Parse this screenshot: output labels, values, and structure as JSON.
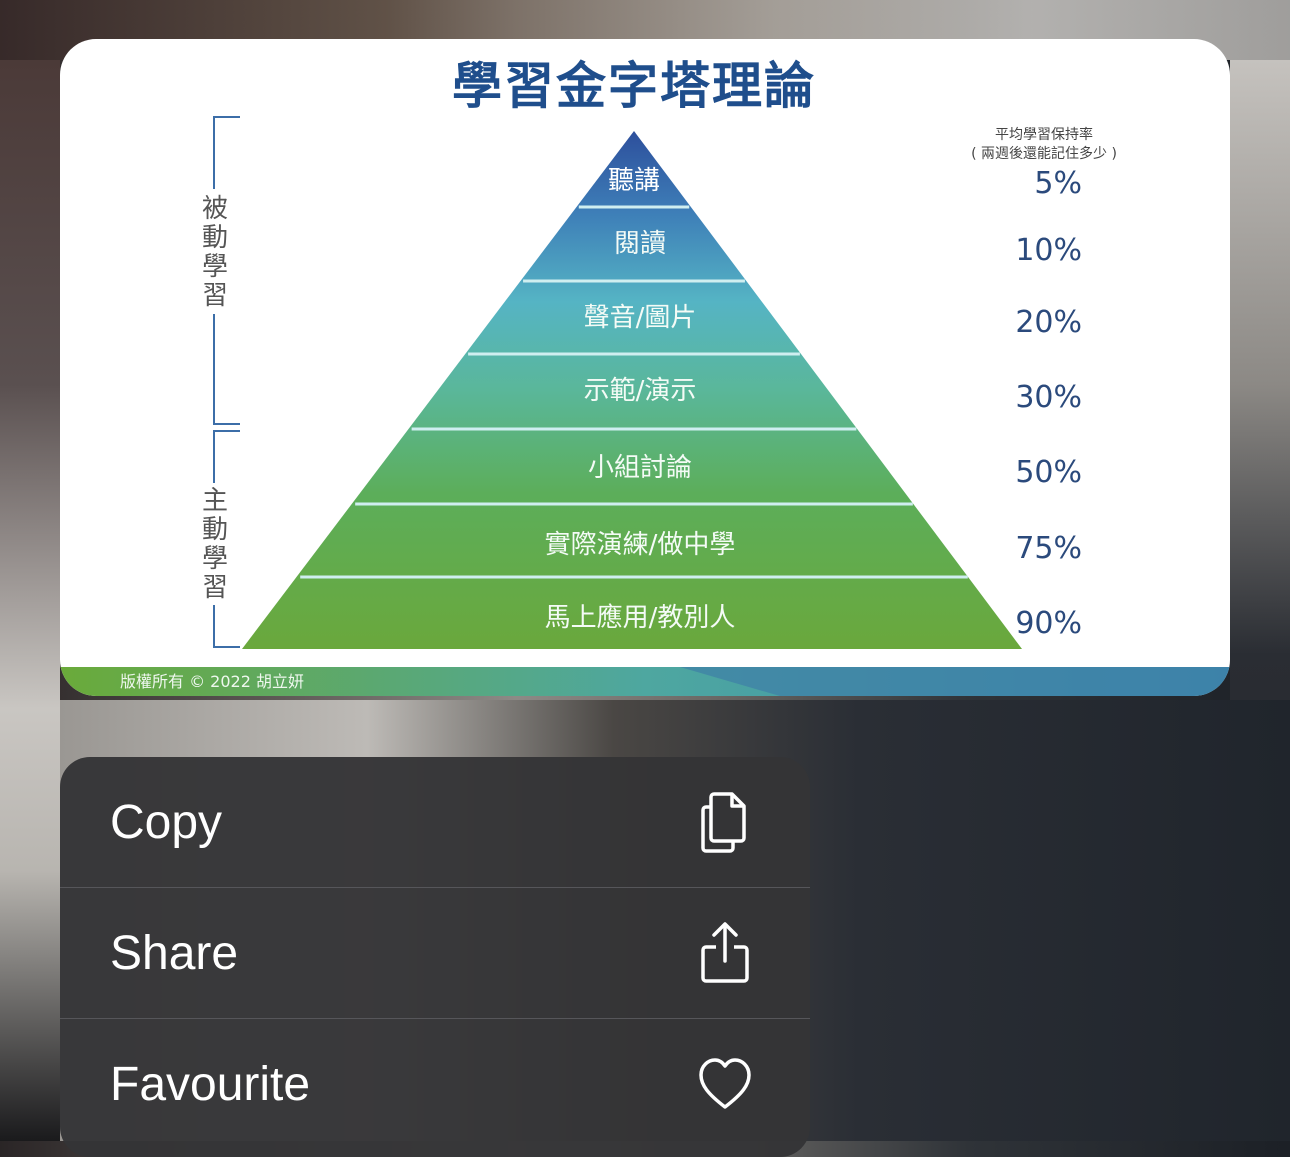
{
  "slide": {
    "title": "學習金字塔理論",
    "passive_label": "被動學習",
    "active_label": "主動學習",
    "rate_header_1": "平均學習保持率",
    "rate_header_2": "( 兩週後還能記住多少 )",
    "levels": [
      {
        "label": "聽講",
        "rate": "5%"
      },
      {
        "label": "閱讀",
        "rate": "10%"
      },
      {
        "label": "聲音/圖片",
        "rate": "20%"
      },
      {
        "label": "示範/演示",
        "rate": "30%"
      },
      {
        "label": "小組討論",
        "rate": "50%"
      },
      {
        "label": "實際演練/做中學",
        "rate": "75%"
      },
      {
        "label": "馬上應用/教別人",
        "rate": "90%"
      }
    ],
    "copyright": "版權所有 © 2022 胡立妍"
  },
  "menu": {
    "items": [
      {
        "label": "Copy",
        "icon": "copy-icon"
      },
      {
        "label": "Share",
        "icon": "share-icon"
      },
      {
        "label": "Favourite",
        "icon": "heart-icon"
      }
    ]
  },
  "colors": {
    "title": "#1f4e8c",
    "pyramid_top": "#2d4f9c",
    "pyramid_mid": "#4fb3c2",
    "pyramid_bottom": "#6aaa3a",
    "menu_bg": "#343436"
  }
}
